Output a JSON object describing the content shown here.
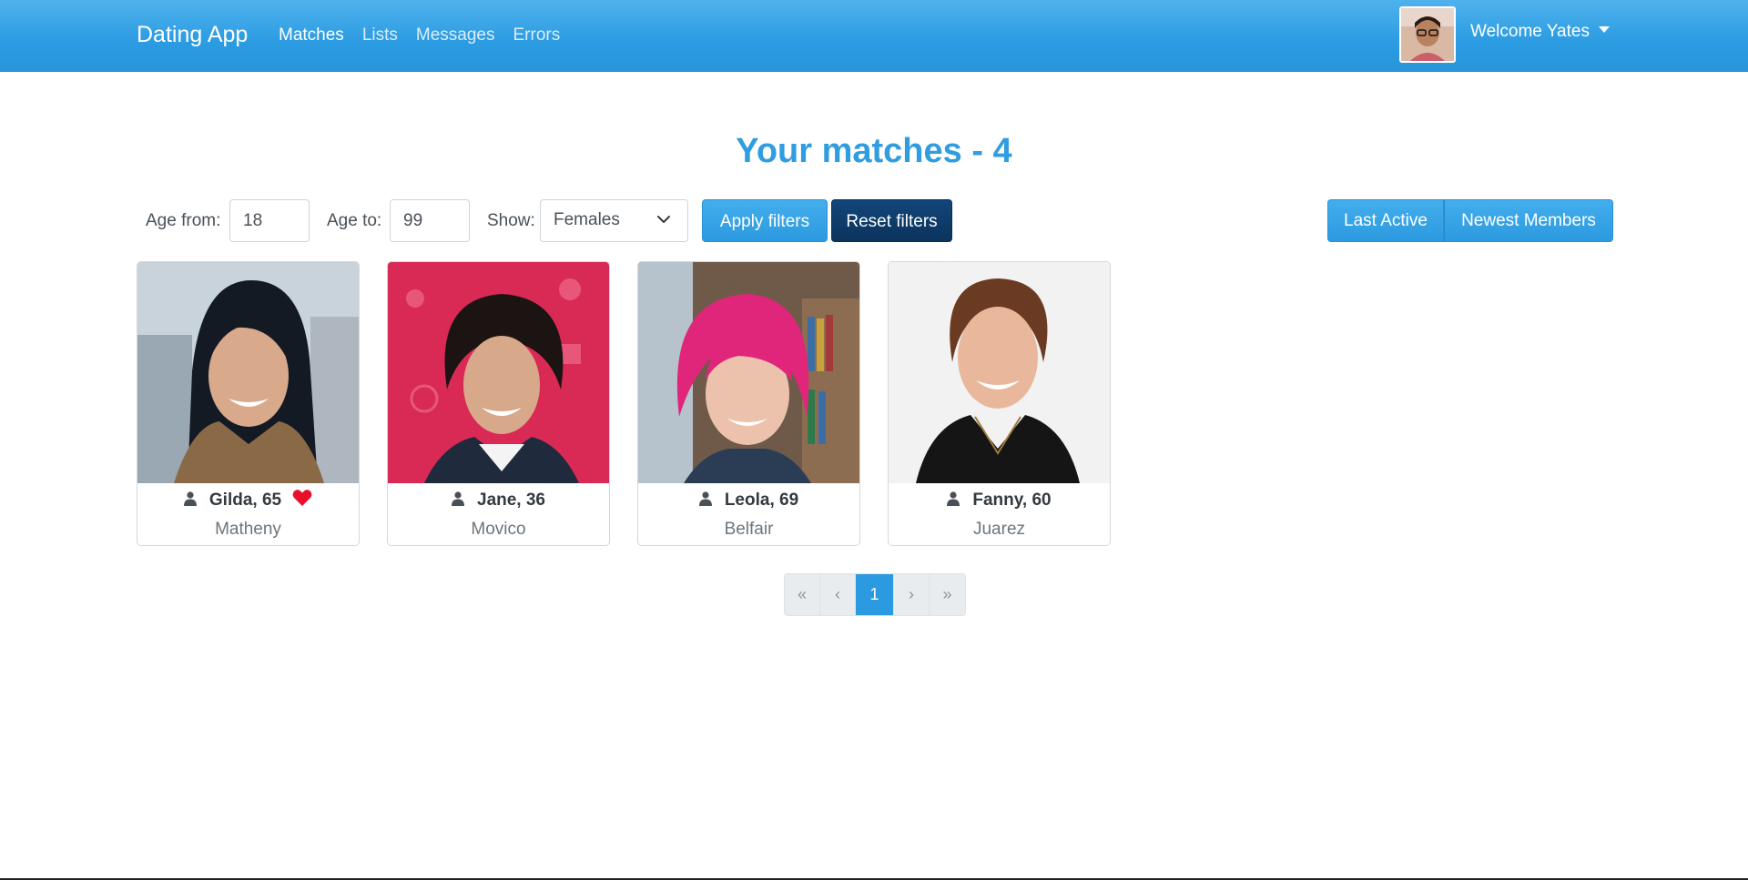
{
  "nav": {
    "brand": "Dating App",
    "links": [
      "Matches",
      "Lists",
      "Messages",
      "Errors"
    ],
    "active_link": "Matches",
    "welcome": "Welcome Yates"
  },
  "page": {
    "title": "Your matches - 4"
  },
  "filters": {
    "age_from_label": "Age from:",
    "age_from_value": "18",
    "age_to_label": "Age to:",
    "age_to_value": "99",
    "show_label": "Show:",
    "show_value": "Females",
    "apply_label": "Apply filters",
    "reset_label": "Reset filters"
  },
  "sort": {
    "last_active": "Last Active",
    "newest_members": "Newest Members"
  },
  "members": [
    {
      "name_age": "Gilda, 65",
      "city": "Matheny",
      "liked": true
    },
    {
      "name_age": "Jane, 36",
      "city": "Movico",
      "liked": false
    },
    {
      "name_age": "Leola, 69",
      "city": "Belfair",
      "liked": false
    },
    {
      "name_age": "Fanny, 60",
      "city": "Juarez",
      "liked": false
    }
  ],
  "pagination": {
    "first": "«",
    "prev": "‹",
    "current": "1",
    "next": "›",
    "last": "»"
  },
  "colors": {
    "navbar": "#2b9be2",
    "title": "#2f9ddf",
    "primary": "#2c9ae0",
    "dark_button": "#0b335c",
    "heart": "#e8102a"
  }
}
